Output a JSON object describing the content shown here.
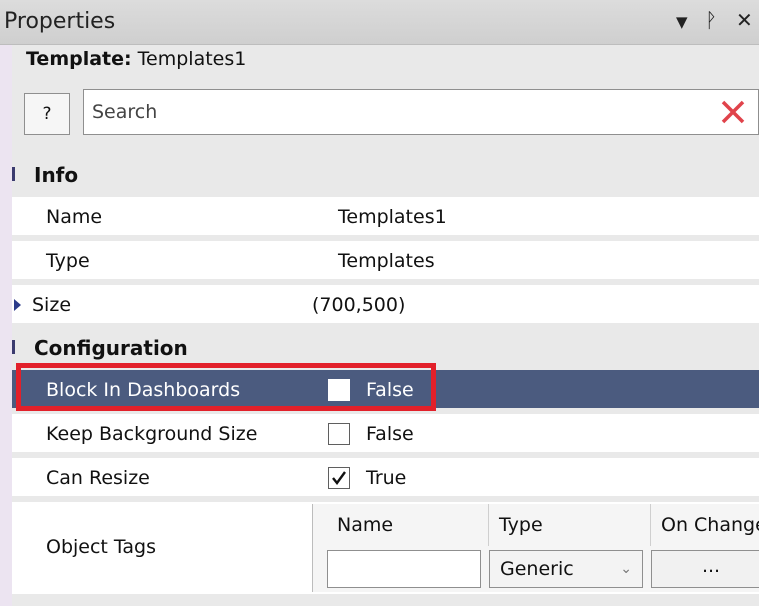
{
  "window": {
    "title": "Properties",
    "dropdown_glyph": "▼",
    "pin_glyph": "ᚹ",
    "close_glyph": "✕"
  },
  "template": {
    "label": "Template:",
    "value": "Templates1"
  },
  "toolbar": {
    "help_label": "?",
    "search_placeholder": "Search"
  },
  "colors": {
    "selected_row": "#4b5b7f",
    "highlight_border": "#e2202a",
    "clear_icon": "#e0434b"
  },
  "sections": {
    "info": {
      "label": "Info",
      "rows": [
        {
          "name": "Name",
          "value": "Templates1"
        },
        {
          "name": "Type",
          "value": "Templates"
        },
        {
          "name": "Size",
          "value": "(700,500)"
        }
      ]
    },
    "configuration": {
      "label": "Configuration",
      "rows": [
        {
          "name": "Block In Dashboards",
          "value": "False",
          "checked": false
        },
        {
          "name": "Keep Background Size",
          "value": "False",
          "checked": false
        },
        {
          "name": "Can Resize",
          "value": "True",
          "checked": true
        }
      ],
      "object_tags": {
        "name": "Object Tags",
        "columns": [
          "Name",
          "Type",
          "On Change"
        ],
        "row": {
          "name": "",
          "type": "Generic",
          "on_change": "..."
        }
      }
    }
  }
}
